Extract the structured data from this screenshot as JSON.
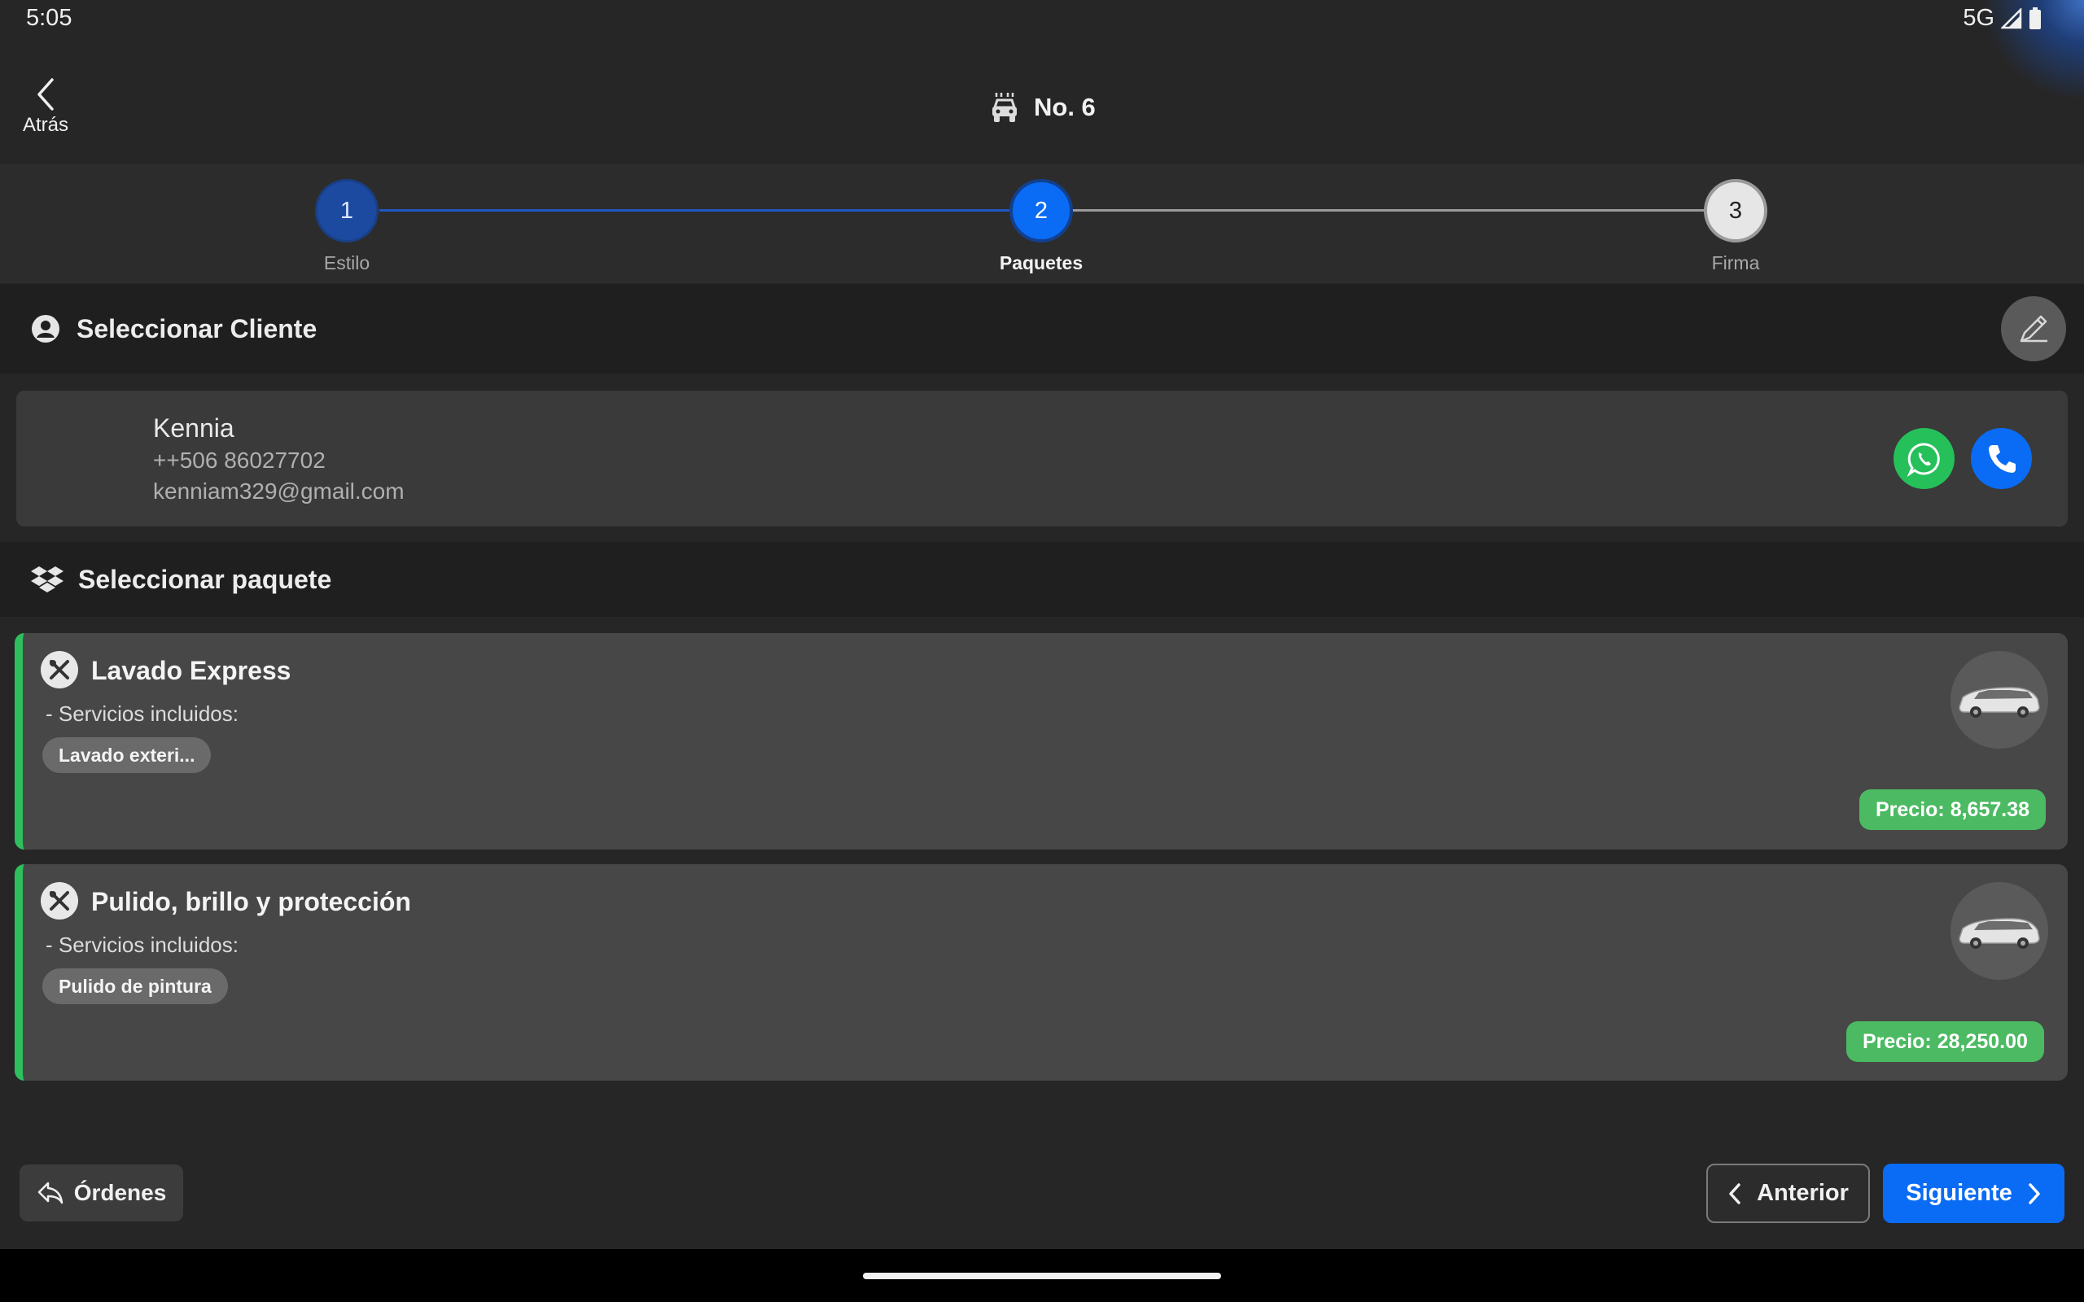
{
  "status_bar": {
    "time": "5:05",
    "network": "5G",
    "signal_icon": "signal-icon",
    "battery_icon": "battery-icon"
  },
  "header": {
    "back_label": "Atrás",
    "title": "No. 6",
    "title_icon": "car-wash-icon"
  },
  "stepper": {
    "steps": [
      {
        "number": "1",
        "label": "Estilo",
        "state": "done"
      },
      {
        "number": "2",
        "label": "Paquetes",
        "state": "active"
      },
      {
        "number": "3",
        "label": "Firma",
        "state": "pending"
      }
    ]
  },
  "client_section": {
    "title": "Seleccionar Cliente",
    "edit_icon": "pencil-icon"
  },
  "client": {
    "name": "Kennia",
    "phone": "++506 86027702",
    "email": "kenniam329@gmail.com",
    "whatsapp_icon": "whatsapp-icon",
    "call_icon": "phone-icon"
  },
  "package_section": {
    "title": "Seleccionar paquete",
    "icon": "dropbox-icon"
  },
  "packages": [
    {
      "title": "Lavado Express",
      "subtitle": "- Servicios incluidos:",
      "chip": "Lavado exteri...",
      "price": "Precio: 8,657.38",
      "accent": "#2fbf5e"
    },
    {
      "title": "Pulido, brillo y protección",
      "subtitle": "- Servicios incluidos:",
      "chip": "Pulido de pintura",
      "price": "Precio: 28,250.00",
      "accent": "#2fbf5e"
    }
  ],
  "footer": {
    "orders_label": "Órdenes",
    "prev_label": "Anterior",
    "next_label": "Siguiente"
  },
  "colors": {
    "primary": "#0a6cf5",
    "step_done": "#1b4aa0",
    "success": "#4cba62",
    "whatsapp": "#25c05a"
  }
}
